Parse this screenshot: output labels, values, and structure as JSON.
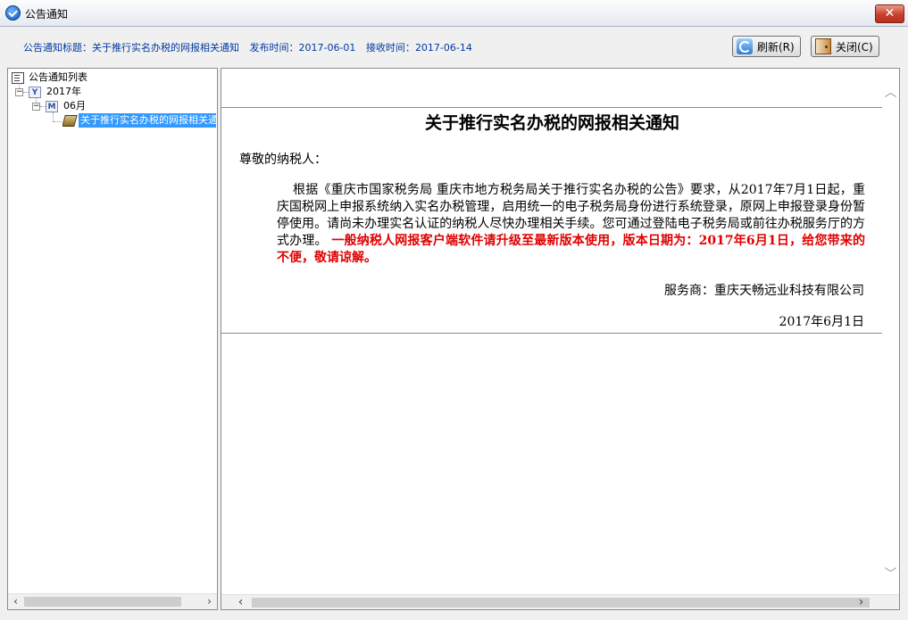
{
  "window": {
    "title": "公告通知",
    "close_label": "✕"
  },
  "info": {
    "title_label": "公告通知标题：",
    "title_value": "关于推行实名办税的网报相关通知",
    "publish_label": "发布时间：",
    "publish_value": "2017-06-01",
    "receive_label": "接收时间：",
    "receive_value": "2017-06-14"
  },
  "toolbar": {
    "refresh_label": "刷新(R)",
    "close_label": "关闭(C)"
  },
  "tree": {
    "root": "公告通知列表",
    "year": "2017年",
    "month": "06月",
    "item": "关于推行实名办税的网报相关通知",
    "year_icon": "Y",
    "month_icon": "M"
  },
  "document": {
    "title": "关于推行实名办税的网报相关通知",
    "greeting": "尊敬的纳税人：",
    "body": "根据《重庆市国家税务局 重庆市地方税务局关于推行实名办税的公告》要求，从2017年7月1日起，重庆国税网上申报系统纳入实名办税管理，启用统一的电子税务局身份进行系统登录，原网上申报登录身份暂停使用。请尚未办理实名认证的纳税人尽快办理相关手续。您可通过登陆电子税务局或前往办税服务厅的方式办理。",
    "notice": "一般纳税人网报客户端软件请升级至最新版本使用，版本日期为：2017年6月1日，给您带来的不便，敬请谅解。",
    "signature": "服务商：重庆天畅远业科技有限公司",
    "date": "2017年6月1日"
  },
  "scroll": {
    "left": "‹",
    "right": "›",
    "up": "︿",
    "down": "﹀"
  },
  "icons": {
    "app": "app-icon",
    "refresh": "refresh-icon",
    "close": "door-icon",
    "tree_root": "list-icon",
    "year": "calendar-year-icon",
    "month": "calendar-month-icon",
    "item": "book-icon"
  },
  "colors": {
    "info_text": "#003aa0",
    "notice_text": "#e00000",
    "selection": "#3399ff",
    "close_button": "#c7402b"
  }
}
